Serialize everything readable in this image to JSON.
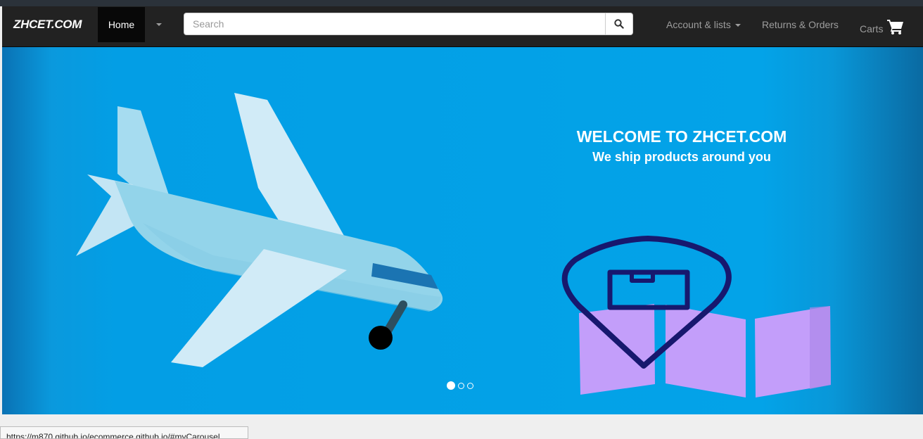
{
  "navbar": {
    "brand": "ZHCET.COM",
    "home_label": "Home",
    "search_placeholder": "Search",
    "account_label": "Account & lists",
    "returns_label": "Returns & Orders",
    "carts_label": "Carts"
  },
  "carousel": {
    "welcome_title": "WELCOME TO ZHCET.COM",
    "welcome_subtitle": "We ship products around you",
    "slide_count": 3,
    "active_slide": 1
  },
  "statusbar": {
    "url": "https://m870.github.io/ecommerce.github.io/#myCarousel"
  },
  "icons": [
    "search-icon",
    "shopping-cart-icon",
    "caret-down-icon",
    "airplane-illustration",
    "location-pin-illustration",
    "map-illustration"
  ],
  "colors": {
    "navbar_bg": "#222222",
    "carousel_bg": "#03a3e8",
    "airplane_light": "#d1ebf7",
    "airplane_body": "#93d4ea",
    "map_purple": "#c39efa",
    "pin_navy": "#17186e"
  }
}
